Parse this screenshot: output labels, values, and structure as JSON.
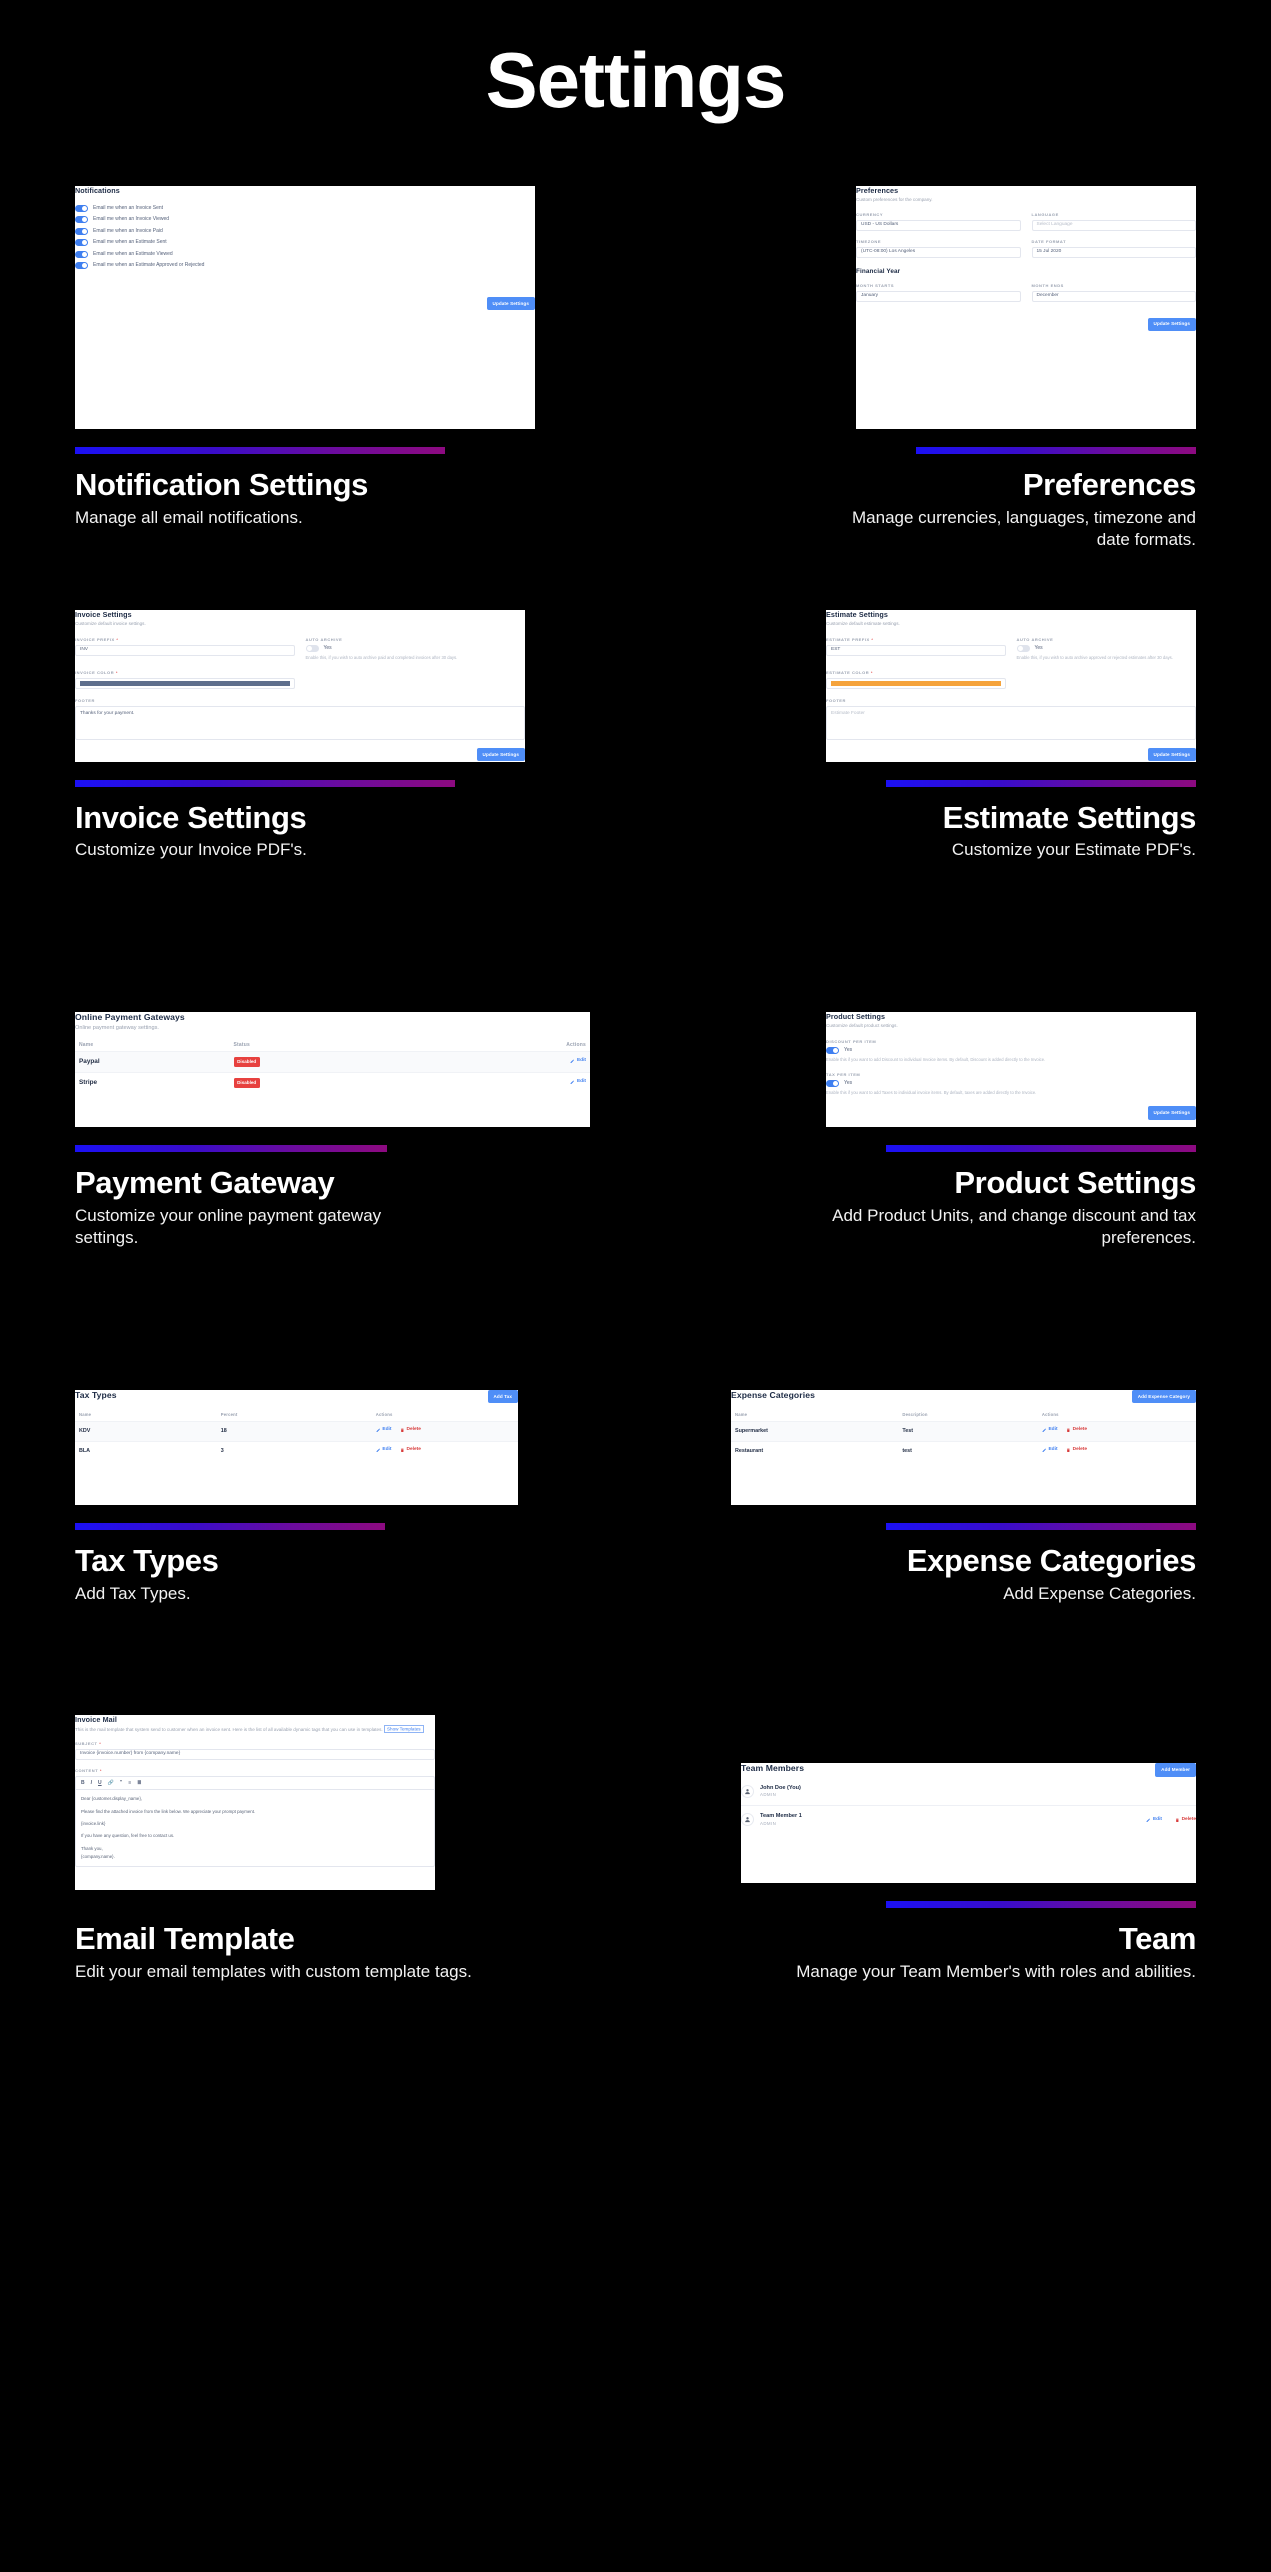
{
  "page": {
    "title": "Settings",
    "accent_from": "#1b10f5",
    "accent_to": "#8d0a80",
    "background": "#000000"
  },
  "sections": [
    {
      "heading": "Notification Settings",
      "description": "Manage all email notifications.",
      "card": {
        "title": "Notifications",
        "toggles": [
          {
            "label": "Email me when an Invoice Sent",
            "state": "on"
          },
          {
            "label": "Email me when an Invoice Viewed",
            "state": "on"
          },
          {
            "label": "Email me when an Invoice Paid",
            "state": "on"
          },
          {
            "label": "Email me when an Estimate Sent",
            "state": "on"
          },
          {
            "label": "Email me when an Estimate Viewed",
            "state": "on"
          },
          {
            "label": "Email me when an Estimate Approved or Rejected",
            "state": "on"
          }
        ],
        "button": "Update Settings"
      }
    },
    {
      "heading": "Preferences",
      "description": "Manage currencies, languages, timezone and date formats.",
      "card": {
        "title": "Preferences",
        "subtitle": "Custom preferences for the company.",
        "fields": [
          {
            "label": "CURRENCY",
            "value": "USD - US Dollars",
            "placeholder": false
          },
          {
            "label": "LANGUAGE",
            "value": "Select Language",
            "placeholder": true
          },
          {
            "label": "TIMEZONE",
            "value": "(UTC-08:00) Los Angeles",
            "placeholder": false
          },
          {
            "label": "DATE FORMAT",
            "value": "15 Jul 2020",
            "placeholder": false
          }
        ],
        "financial_year_title": "Financial Year",
        "fy_fields": [
          {
            "label": "MONTH STARTS",
            "value": "January"
          },
          {
            "label": "MONTH ENDS",
            "value": "December"
          }
        ],
        "button": "Update Settings"
      }
    },
    {
      "heading": "Invoice Settings",
      "description": "Customize your Invoice PDF's.",
      "card": {
        "title": "Invoice Settings",
        "subtitle": "Customize default invoice settings.",
        "prefix_label": "INVOICE PREFIX",
        "prefix_value": "INV",
        "archive_label": "AUTO ARCHIVE",
        "archive_state": "off",
        "archive_value": "Yes",
        "archive_help": "Enable this, if you wish to auto archive paid and completed invoices after 30 days.",
        "color_label": "INVOICE COLOR",
        "color_value": "#5e6e8c",
        "footer_label": "FOOTER",
        "footer_value": "Thanks for your payment.",
        "footer_is_placeholder": false,
        "button": "Update Settings"
      }
    },
    {
      "heading": "Estimate Settings",
      "description": "Customize your Estimate PDF's.",
      "card": {
        "title": "Estimate Settings",
        "subtitle": "Customize default estimate settings.",
        "prefix_label": "ESTIMATE PREFIX",
        "prefix_value": "EST",
        "archive_label": "AUTO ARCHIVE",
        "archive_state": "off",
        "archive_value": "Yes",
        "archive_help": "Enable this, if you wish to auto archive approved or rejected estimates after 30 days.",
        "color_label": "ESTIMATE COLOR",
        "color_value": "#f5a33c",
        "footer_label": "FOOTER",
        "footer_value": "Estimate Footer",
        "footer_is_placeholder": true,
        "button": "Update Settings"
      }
    },
    {
      "heading": "Payment Gateway",
      "description": "Customize your online payment gateway settings.",
      "card": {
        "title": "Online Payment Gateways",
        "subtitle": "Online payment gateway settings.",
        "columns": [
          "Name",
          "Status",
          "Actions"
        ],
        "rows": [
          {
            "name": "Paypal",
            "status": "Disabled",
            "action": "Edit"
          },
          {
            "name": "Stripe",
            "status": "Disabled",
            "action": "Edit"
          }
        ]
      }
    },
    {
      "heading": "Product Settings",
      "description": "Add Product Units, and change discount and tax preferences.",
      "card": {
        "title": "Product Settings",
        "subtitle": "Customize default product settings.",
        "options": [
          {
            "label": "DISCOUNT PER ITEM",
            "state": "on",
            "value": "Yes",
            "help": "Enable this if you want to add Discount to individual Invoice items. By default, Discount is added directly to the Invoice."
          },
          {
            "label": "TAX PER ITEM",
            "state": "on",
            "value": "Yes",
            "help": "Enable this if you want to add Taxes to individual invoice items. By default, taxes are added directly to the Invoice."
          }
        ],
        "button": "Update Settings"
      }
    },
    {
      "heading": "Tax Types",
      "description": "Add Tax Types.",
      "card": {
        "title": "Tax Types",
        "add_button": "Add Tax",
        "columns": [
          "Name",
          "Percent",
          "Actions"
        ],
        "rows": [
          {
            "name": "KDV",
            "percent": "18",
            "edit": "Edit",
            "delete": "Delete"
          },
          {
            "name": "BLA",
            "percent": "3",
            "edit": "Edit",
            "delete": "Delete"
          }
        ]
      }
    },
    {
      "heading": "Expense Categories",
      "description": "Add Expense Categories.",
      "card": {
        "title": "Expense Categories",
        "add_button": "Add Expense Category",
        "columns": [
          "Name",
          "Description",
          "Actions"
        ],
        "rows": [
          {
            "name": "Supermarket",
            "description": "Test",
            "edit": "Edit",
            "delete": "Delete"
          },
          {
            "name": "Restaurant",
            "description": "test",
            "edit": "Edit",
            "delete": "Delete"
          }
        ]
      }
    },
    {
      "heading": "Email Template",
      "description": "Edit your email templates with custom template tags.",
      "card": {
        "title": "Invoice Mail",
        "subtitle_a": "This is the mail template that system send to customer when an invoice sent. Here is the list of all available dynamic tags that you can use in templates.",
        "subtitle_link": "Show Templates",
        "subject_label": "SUBJECT",
        "subject_value": "Invoice {invoice.number} from {company.name}",
        "content_label": "CONTENT",
        "toolbar": [
          "B",
          "I",
          "U",
          "link-icon",
          "quote-icon",
          "ordered-list-icon",
          "bullet-list-icon"
        ],
        "body_lines": [
          "Dear {customer.display_name},",
          "Please find the attached invoice from the link below. We appreciate your prompt payment.",
          "{invoice.link}",
          "If you have any question, feel free to contact us.",
          "Thank you,",
          "{company.name}."
        ]
      }
    },
    {
      "heading": "Team",
      "description": "Manage your Team Member's with roles and abilities.",
      "card": {
        "title": "Team Members",
        "add_button": "Add Member",
        "members": [
          {
            "name": "John Doe (You)",
            "role": "ADMIN",
            "actions": []
          },
          {
            "name": "Team Member 1",
            "role": "ADMIN",
            "actions": [
              "Edit",
              "Delete"
            ]
          }
        ]
      }
    }
  ]
}
